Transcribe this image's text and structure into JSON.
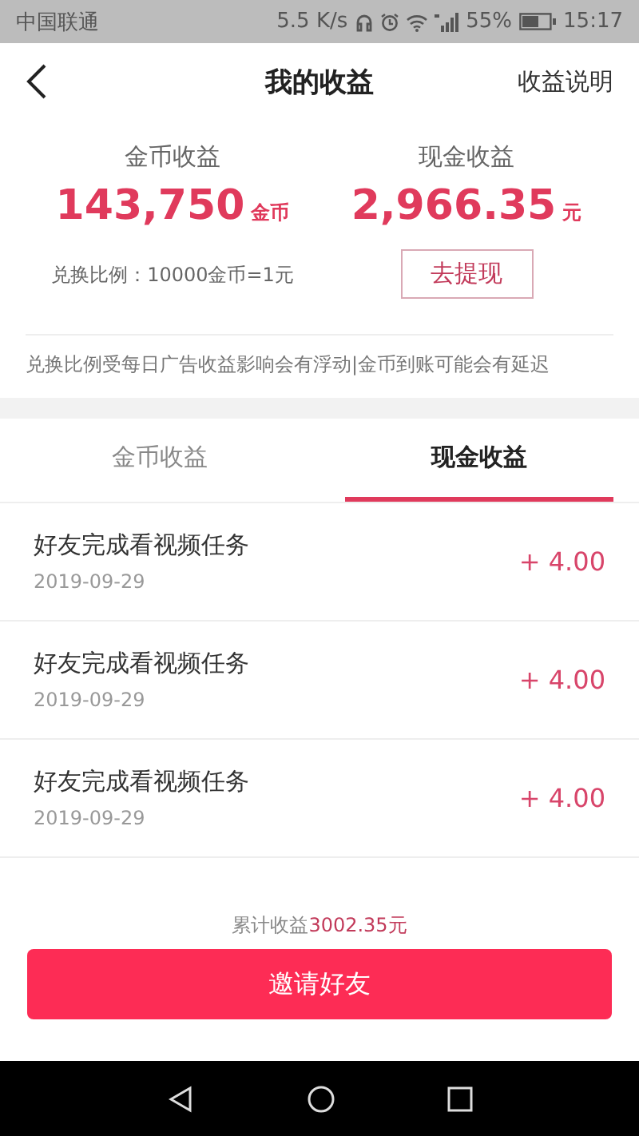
{
  "status_bar": {
    "carrier": "中国联通",
    "speed": "5.5 K/s",
    "battery": "55%",
    "time": "15:17"
  },
  "header": {
    "title": "我的收益",
    "action": "收益说明"
  },
  "summary": {
    "coin": {
      "label": "金币收益",
      "value": "143,750",
      "unit": "金币"
    },
    "cash": {
      "label": "现金收益",
      "value": "2,966.35",
      "unit": "元"
    },
    "rate": "兑换比例：10000金币=1元",
    "withdraw_button": "去提现",
    "notice": "兑换比例受每日广告收益影响会有浮动|金币到账可能会有延迟"
  },
  "tabs": [
    {
      "label": "金币收益",
      "selected": false
    },
    {
      "label": "现金收益",
      "selected": true
    }
  ],
  "records": [
    {
      "title": "好友完成看视频任务",
      "date": "2019-09-29",
      "amount": "+ 4.00"
    },
    {
      "title": "好友完成看视频任务",
      "date": "2019-09-29",
      "amount": "+ 4.00"
    },
    {
      "title": "好友完成看视频任务",
      "date": "2019-09-29",
      "amount": "+ 4.00"
    }
  ],
  "total": {
    "label": "累计收益",
    "amount": "3002.35元"
  },
  "invite_button": "邀请好友"
}
